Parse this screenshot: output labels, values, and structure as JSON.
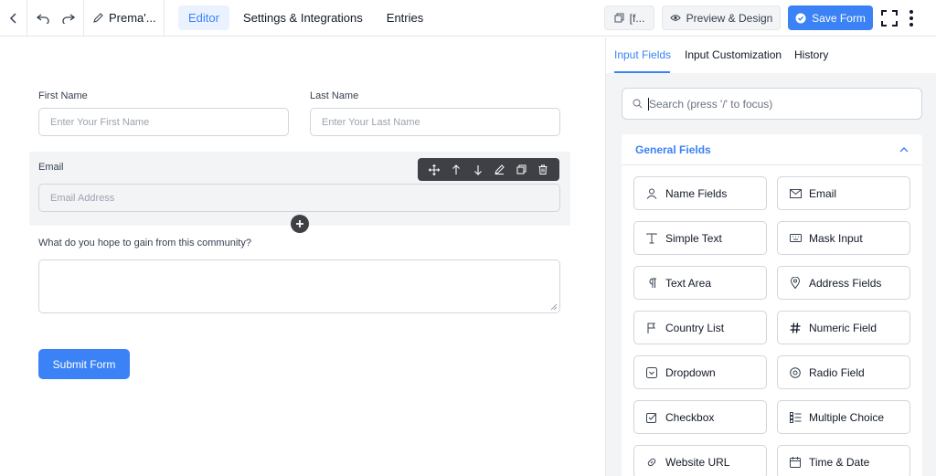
{
  "topbar": {
    "form_title": "Prema'...",
    "tabs": [
      {
        "label": "Editor",
        "active": true
      },
      {
        "label": "Settings & Integrations",
        "active": false
      },
      {
        "label": "Entries",
        "active": false
      }
    ],
    "shortcode_label": "[f...",
    "preview_label": "Preview & Design",
    "save_label": "Save Form"
  },
  "form": {
    "first_name": {
      "label": "First Name",
      "placeholder": "Enter Your First Name"
    },
    "last_name": {
      "label": "Last Name",
      "placeholder": "Enter Your Last Name"
    },
    "email": {
      "label": "Email",
      "placeholder": "Email Address"
    },
    "question": {
      "label": "What do you hope to gain from this community?"
    },
    "submit_label": "Submit Form"
  },
  "panel": {
    "tabs": [
      {
        "label": "Input Fields",
        "active": true
      },
      {
        "label": "Input Customization",
        "active": false
      },
      {
        "label": "History",
        "active": false
      }
    ],
    "search_placeholder": "Search (press '/' to focus)",
    "section_title": "General Fields",
    "fields": [
      {
        "label": "Name Fields",
        "icon": "user-icon"
      },
      {
        "label": "Email",
        "icon": "envelope-icon"
      },
      {
        "label": "Simple Text",
        "icon": "text-cursor-icon"
      },
      {
        "label": "Mask Input",
        "icon": "keyboard-icon"
      },
      {
        "label": "Text Area",
        "icon": "paragraph-icon"
      },
      {
        "label": "Address Fields",
        "icon": "map-pin-icon"
      },
      {
        "label": "Country List",
        "icon": "flag-icon"
      },
      {
        "label": "Numeric Field",
        "icon": "hash-icon"
      },
      {
        "label": "Dropdown",
        "icon": "dropdown-icon"
      },
      {
        "label": "Radio Field",
        "icon": "radio-icon"
      },
      {
        "label": "Checkbox",
        "icon": "checkbox-icon"
      },
      {
        "label": "Multiple Choice",
        "icon": "list-icon"
      },
      {
        "label": "Website URL",
        "icon": "link-icon"
      },
      {
        "label": "Time & Date",
        "icon": "calendar-icon"
      }
    ]
  },
  "colors": {
    "accent": "#3b82f6",
    "toolbar": "#3f3f46",
    "panel_bg": "#f3f4f6"
  }
}
